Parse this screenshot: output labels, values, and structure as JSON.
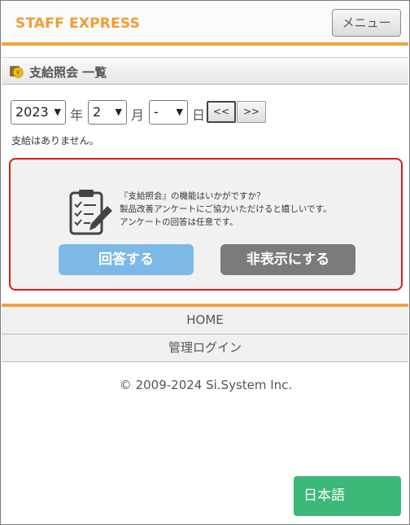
{
  "header": {
    "logo": "STAFF EXPRESS",
    "menu_label": "メニュー"
  },
  "section": {
    "title": "支給照会 一覧"
  },
  "filter": {
    "year": "2023",
    "year_unit": "年",
    "month": "2",
    "month_unit": "月",
    "day": "-",
    "day_unit": "日",
    "prev_label": "<<",
    "next_label": ">>"
  },
  "message": "支給はありません。",
  "survey": {
    "line1": "『支給照会』の機能はいかがですか？",
    "line2": "製品改善アンケートにご協力いただけると嬉しいです。",
    "line3": "アンケートの回答は任意です。",
    "answer_label": "回答する",
    "hide_label": "非表示にする"
  },
  "footer": {
    "home": "HOME",
    "admin_login": "管理ログイン",
    "copyright": "© 2009-2024 Si.System Inc."
  },
  "language_button": "日本語",
  "colors": {
    "accent": "#f2a23c",
    "survey_border": "#e01a1a",
    "answer_button": "#7cb9e6",
    "hide_button": "#7b7b7b",
    "language_button": "#3cb878"
  }
}
